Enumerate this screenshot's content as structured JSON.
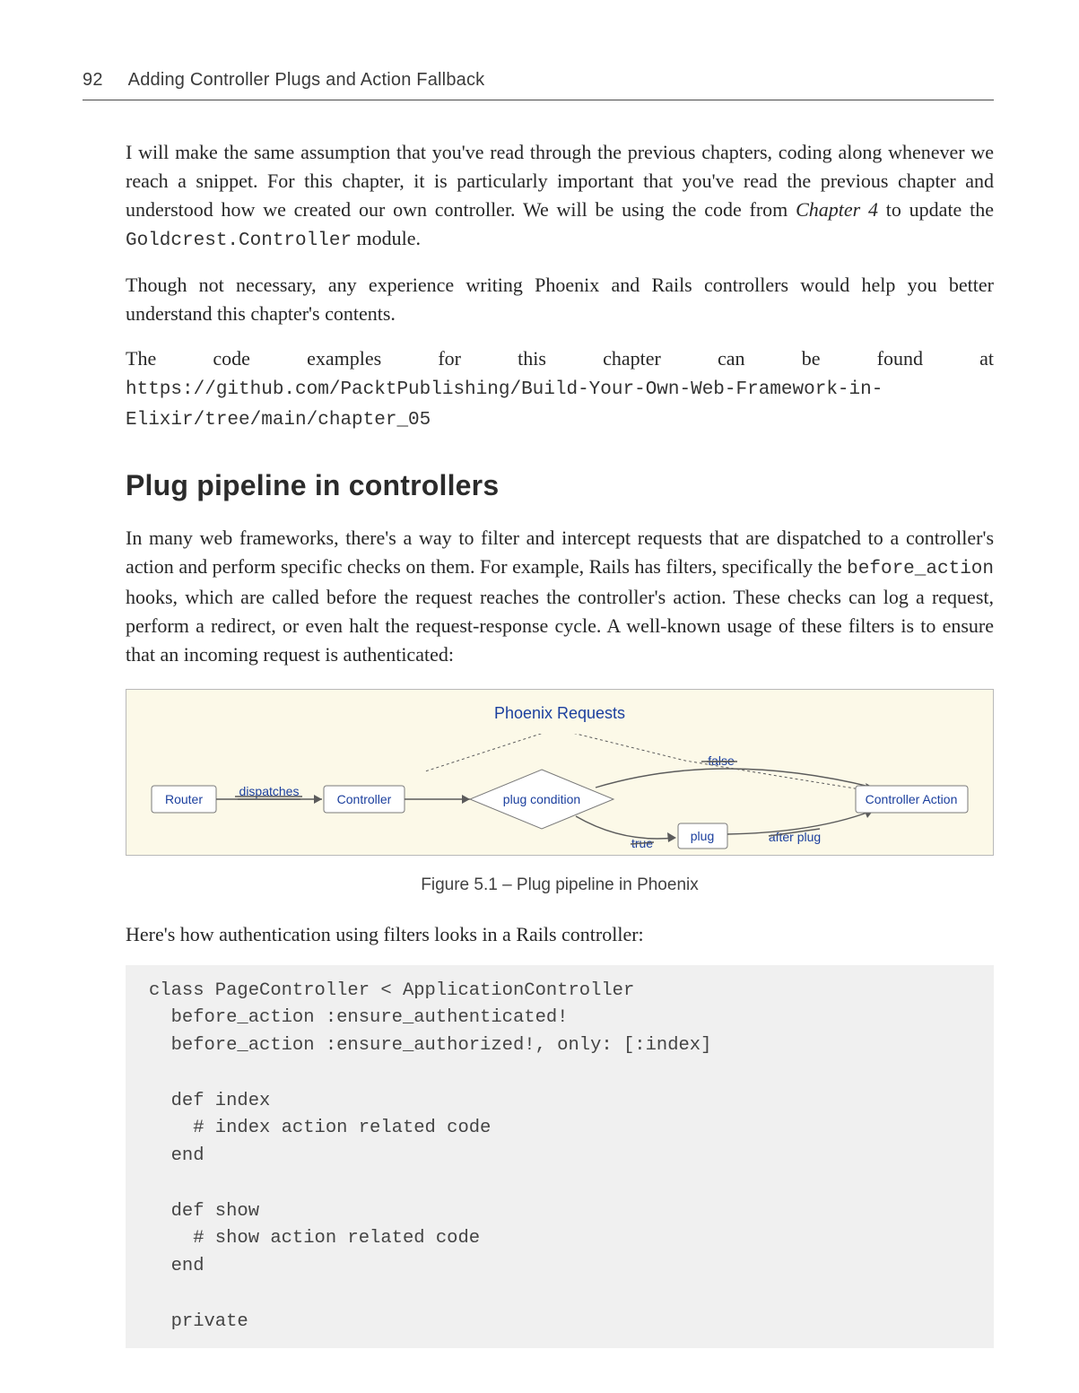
{
  "header": {
    "page_number": "92",
    "running_title": "Adding Controller Plugs and Action Fallback"
  },
  "paragraphs": {
    "p1_a": "I will make the same assumption that you've read through the previous chapters, coding along whenever we reach a snippet. For this chapter, it is particularly important that you've read the previous chapter and understood how we created our own controller. We will be using the code from ",
    "p1_ital": "Chapter 4",
    "p1_b": " to update the ",
    "p1_mono": "Goldcrest.Controller",
    "p1_c": " module.",
    "p2": "Though not necessary, any experience writing Phoenix and Rails controllers would help you better understand this chapter's contents.",
    "p3_a": "The code examples for this chapter can be found at ",
    "p3_mono": "https://github.com/PacktPublishing/Build-Your-Own-Web-Framework-in-Elixir/tree/main/chapter_05",
    "section_heading": "Plug pipeline in controllers",
    "p4_a": "In many web frameworks, there's a way to filter and intercept requests that are dispatched to a controller's action and perform specific checks on them. For example, Rails has filters, specifically the ",
    "p4_mono": "before_action",
    "p4_b": " hooks, which are called before the request reaches the controller's action. These checks can log a request, perform a redirect, or even halt the request-response cycle. A well-known usage of these filters is to ensure that an incoming request is authenticated:",
    "p5": "Here's how authentication using filters looks in a Rails controller:"
  },
  "figure": {
    "title": "Phoenix Requests",
    "caption": "Figure 5.1 – Plug pipeline in Phoenix",
    "labels": {
      "router": "Router",
      "controller": "Controller",
      "condition": "plug condition",
      "plug": "plug",
      "action": "Controller Action",
      "dispatches": "dispatches",
      "true": "true",
      "false": "false",
      "after_plug": "after plug"
    }
  },
  "code": "class PageController < ApplicationController\n  before_action :ensure_authenticated!\n  before_action :ensure_authorized!, only: [:index]\n\n  def index\n    # index action related code\n  end\n\n  def show\n    # show action related code\n  end\n\n  private"
}
